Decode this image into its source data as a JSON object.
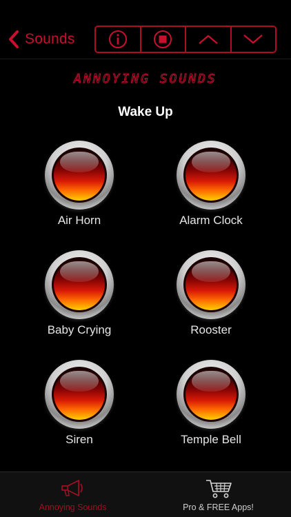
{
  "nav": {
    "back_label": "Sounds",
    "controls": [
      {
        "name": "info-button",
        "icon": "info-icon"
      },
      {
        "name": "stop-button",
        "icon": "stop-icon"
      },
      {
        "name": "previous-button",
        "icon": "chevron-up-icon"
      },
      {
        "name": "next-button",
        "icon": "chevron-down-icon"
      }
    ],
    "accent_color": "#c8102e"
  },
  "brand_title": "Annoying Sounds",
  "section_title": "Wake Up",
  "sounds": [
    {
      "label": "Air Horn"
    },
    {
      "label": "Alarm Clock"
    },
    {
      "label": "Baby Crying"
    },
    {
      "label": "Rooster"
    },
    {
      "label": "Siren"
    },
    {
      "label": "Temple Bell"
    }
  ],
  "tabs": [
    {
      "label": "Annoying Sounds",
      "icon": "megaphone-icon",
      "active": true
    },
    {
      "label": "Pro & FREE Apps!",
      "icon": "shopping-cart-icon",
      "active": false
    }
  ]
}
